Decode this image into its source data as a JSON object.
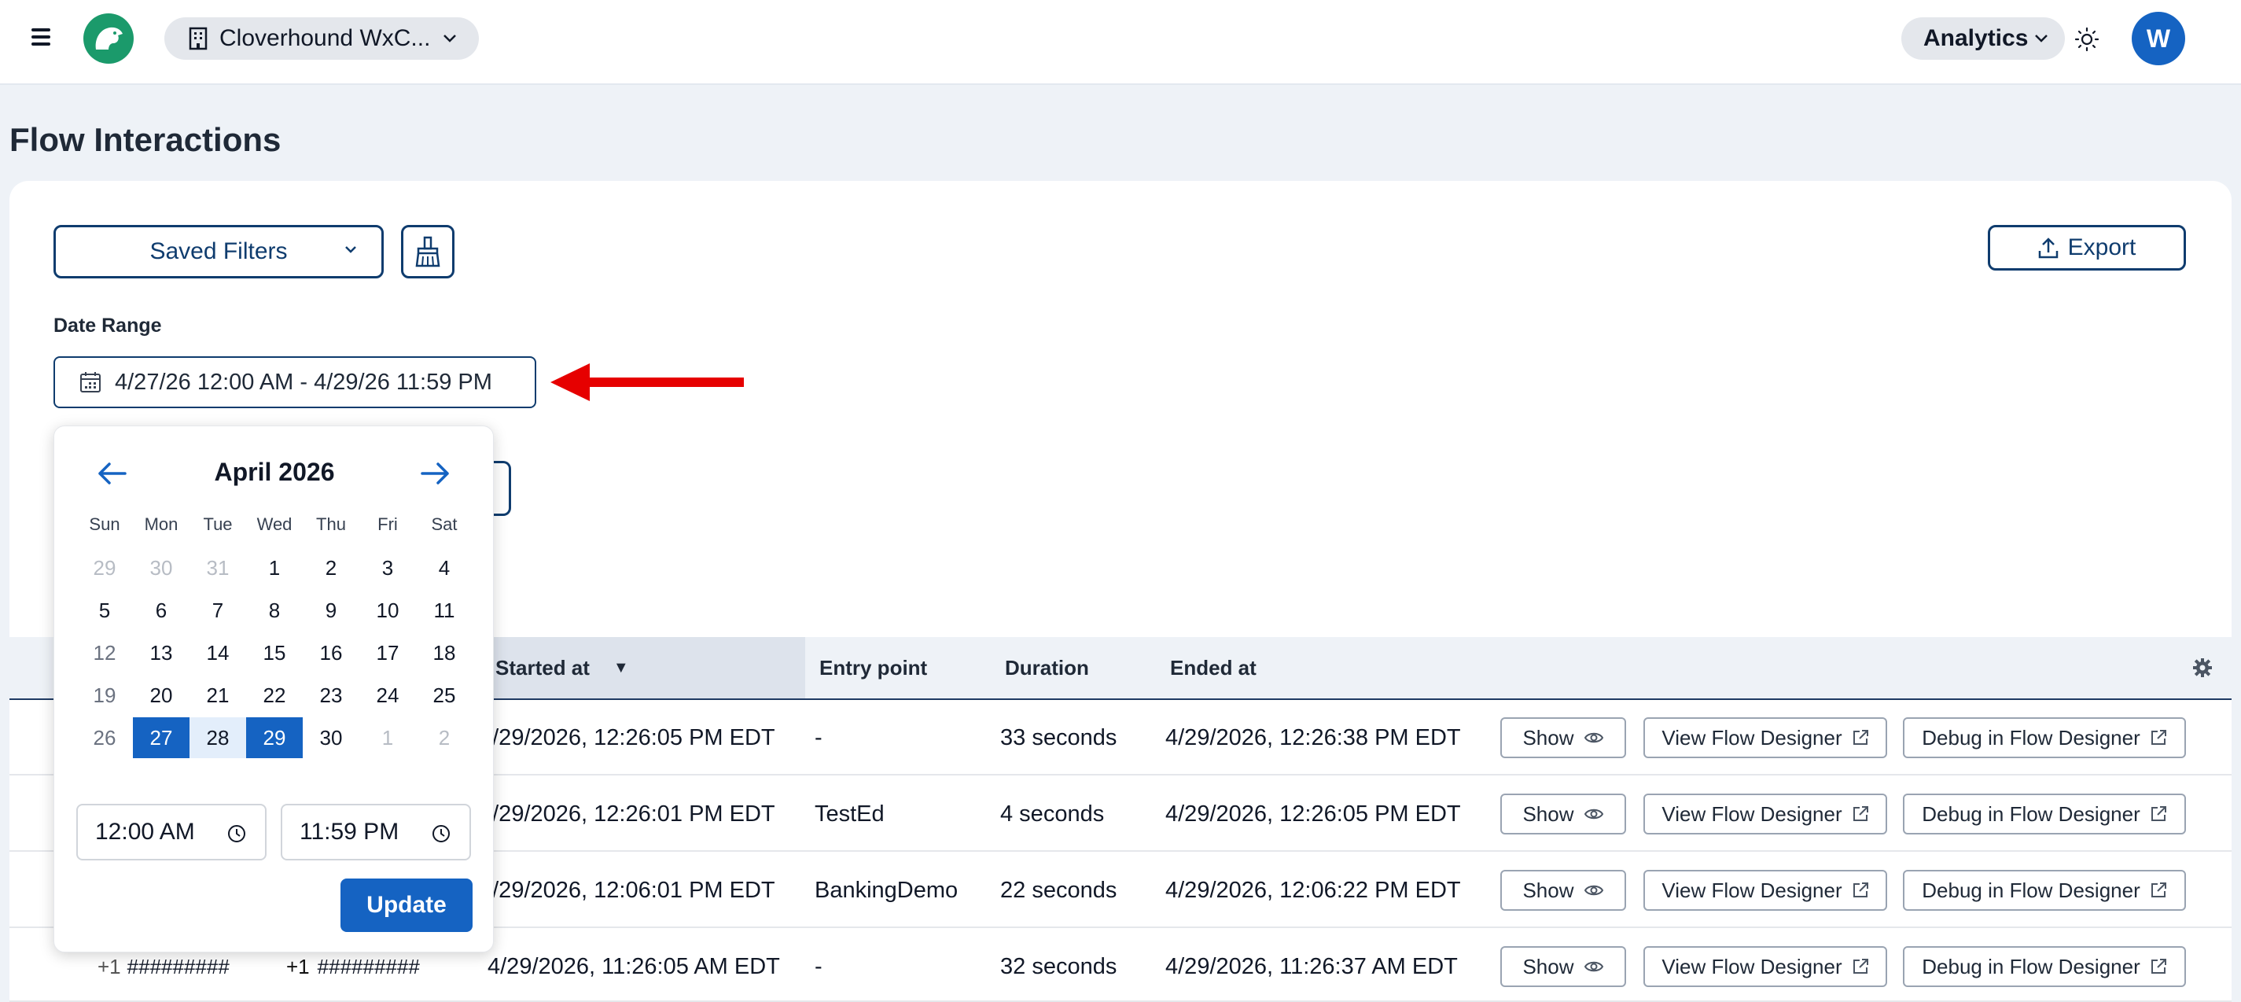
{
  "header": {
    "org_name": "Cloverhound WxC...",
    "analytics_label": "Analytics",
    "avatar_initial": "W"
  },
  "page": {
    "title": "Flow Interactions"
  },
  "filters": {
    "saved_filters_label": "Saved Filters",
    "export_label": "Export",
    "date_range_label": "Date Range",
    "date_range_value": "4/27/26 12:00 AM - 4/29/26 11:59 PM"
  },
  "calendar": {
    "month_title": "April 2026",
    "weekdays": [
      "Sun",
      "Mon",
      "Tue",
      "Wed",
      "Thu",
      "Fri",
      "Sat"
    ],
    "weeks": [
      [
        "29",
        "30",
        "31",
        "1",
        "2",
        "3",
        "4"
      ],
      [
        "5",
        "6",
        "7",
        "8",
        "9",
        "10",
        "11"
      ],
      [
        "12",
        "13",
        "14",
        "15",
        "16",
        "17",
        "18"
      ],
      [
        "19",
        "20",
        "21",
        "22",
        "23",
        "24",
        "25"
      ],
      [
        "26",
        "27",
        "28",
        "29",
        "30",
        "1",
        "2"
      ]
    ],
    "start_time": "12:00 AM",
    "end_time": "11:59 PM",
    "update_label": "Update"
  },
  "table": {
    "headers": {
      "started_at": "Started at",
      "entry_point": "Entry point",
      "duration": "Duration",
      "ended_at": "Ended at"
    },
    "show_label": "Show",
    "view_label": "View Flow Designer",
    "debug_label": "Debug in Flow Designer",
    "rows": [
      {
        "started": "4/29/2026, 12:26:05 PM EDT",
        "entry": "-",
        "duration": "33 seconds",
        "ended": "4/29/2026, 12:26:38 PM EDT"
      },
      {
        "started": "4/29/2026, 12:26:01 PM EDT",
        "entry": "TestEd",
        "duration": "4 seconds",
        "ended": "4/29/2026, 12:26:05 PM EDT"
      },
      {
        "started": "4/29/2026, 12:06:01 PM EDT",
        "entry": "BankingDemo",
        "duration": "22 seconds",
        "ended": "4/29/2026, 12:06:22 PM EDT"
      },
      {
        "started": "4/29/2026, 11:26:05 AM EDT",
        "entry": "-",
        "duration": "32 seconds",
        "ended": "4/29/2026, 11:26:37 AM EDT",
        "from_prefix": "+1",
        "from": "#########",
        "to_prefix": "+1",
        "to": "#########"
      }
    ]
  },
  "colors": {
    "primary": "#1563c2",
    "navy": "#0f3c6e",
    "annotation_arrow": "#e60000",
    "brand_green": "#1b9a6b"
  }
}
